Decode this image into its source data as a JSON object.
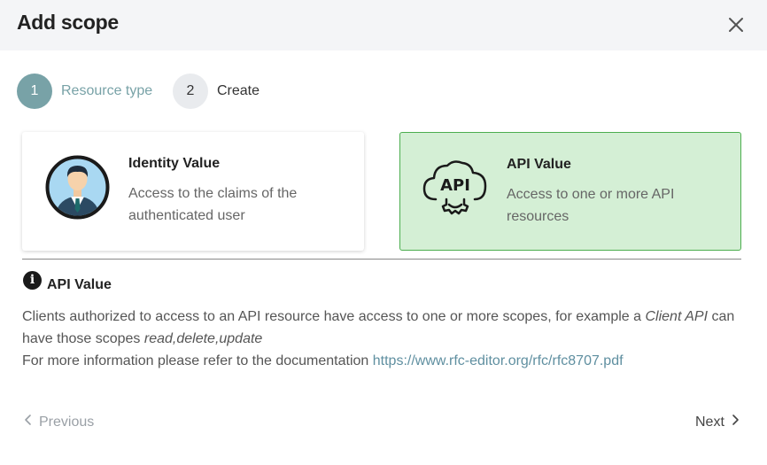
{
  "dialog": {
    "title": "Add scope",
    "close_icon": "close-icon"
  },
  "steps": [
    {
      "number": "1",
      "label": "Resource type",
      "state": "active",
      "color": "#78a2a7"
    },
    {
      "number": "2",
      "label": "Create",
      "state": "pending"
    }
  ],
  "cards": [
    {
      "title": "Identity Value",
      "description": "Access to the claims of the authenticated user",
      "icon": "user-avatar-icon",
      "selected": false
    },
    {
      "title": "API Value",
      "description": "Access to one or more API resources",
      "icon": "api-gear-icon",
      "selected": true,
      "selected_bg": "#d4efd5",
      "selected_border": "#4cae4f"
    }
  ],
  "info": {
    "icon": "info-icon",
    "title": "API Value",
    "text_1": "Clients authorized to access to an API resource have access to one or more scopes, for example a ",
    "text_1_em": "Client API",
    "text_1_end": " can have those scopes ",
    "text_2_em": "read,delete,update",
    "text_3": "For more information please refer to the documentation ",
    "link": "https://www.rfc-editor.org/rfc/rfc8707.pdf",
    "link_color": "#5f8fa0"
  },
  "footer": {
    "previous_label": "Previous",
    "next_label": "Next",
    "previous_icon": "chevron-left-icon",
    "next_icon": "chevron-right-icon"
  }
}
